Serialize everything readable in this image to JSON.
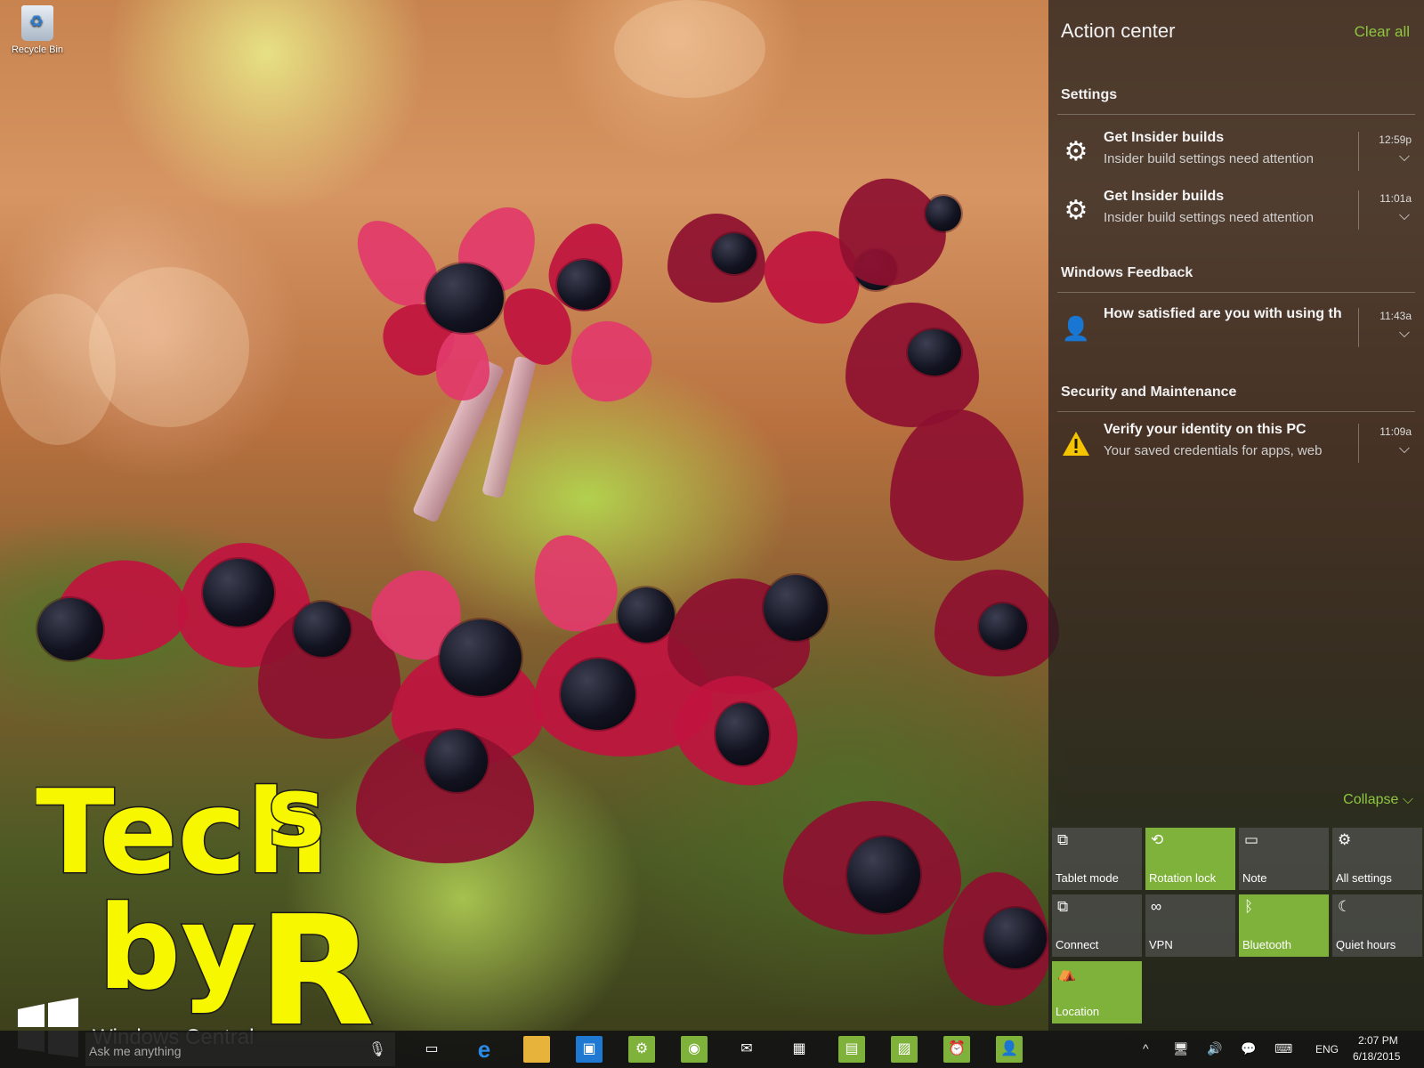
{
  "desktop": {
    "recycle_bin_label": "Recycle Bin"
  },
  "action_center": {
    "title": "Action center",
    "clear_all": "Clear all",
    "groups": [
      {
        "header": "Settings",
        "notifications": [
          {
            "icon": "gear-icon",
            "title": "Get Insider builds",
            "body": "Insider build settings need attention",
            "time": "12:59p"
          },
          {
            "icon": "gear-icon",
            "title": "Get Insider builds",
            "body": "Insider build settings need attention",
            "time": "11:01a"
          }
        ]
      },
      {
        "header": "Windows Feedback",
        "notifications": [
          {
            "icon": "feedback-icon",
            "title": "How satisfied are you with using th",
            "body": "",
            "time": "11:43a"
          }
        ]
      },
      {
        "header": "Security and Maintenance",
        "notifications": [
          {
            "icon": "warning-icon",
            "title": "Verify your identity on this PC",
            "body": "Your saved credentials for apps, web",
            "time": "11:09a"
          }
        ]
      }
    ],
    "collapse_label": "Collapse",
    "quick_actions": [
      {
        "label": "Tablet mode",
        "icon": "tablet-mode-icon",
        "active": false
      },
      {
        "label": "Rotation lock",
        "icon": "rotation-lock-icon",
        "active": true
      },
      {
        "label": "Note",
        "icon": "note-icon",
        "active": false
      },
      {
        "label": "All settings",
        "icon": "settings-icon",
        "active": false
      },
      {
        "label": "Connect",
        "icon": "connect-icon",
        "active": false
      },
      {
        "label": "VPN",
        "icon": "vpn-icon",
        "active": false
      },
      {
        "label": "Bluetooth",
        "icon": "bluetooth-icon",
        "active": true
      },
      {
        "label": "Quiet hours",
        "icon": "moon-icon",
        "active": false
      },
      {
        "label": "Location",
        "icon": "location-icon",
        "active": true
      }
    ]
  },
  "taskbar": {
    "search_placeholder": "Ask me anything",
    "pinned_apps": [
      "task-view-icon",
      "edge-icon",
      "file-explorer-icon",
      "store-icon",
      "settings-app-icon",
      "maps-icon",
      "mail-icon",
      "calendar-icon",
      "calculator-icon",
      "photos-icon",
      "alarms-icon",
      "people-icon"
    ],
    "language": "ENG",
    "time": "2:07 PM",
    "date": "6/18/2015"
  },
  "watermarks": {
    "brand": "Windows Central",
    "overlay_text": "Techs by R"
  },
  "colors": {
    "accent": "#7fb23a",
    "accent_text": "#8dc63f",
    "panel_bg": "rgba(28,28,28,0.72)",
    "tile_inactive": "rgba(95,95,95,0.55)",
    "watermark_yellow": "#f7f700"
  }
}
